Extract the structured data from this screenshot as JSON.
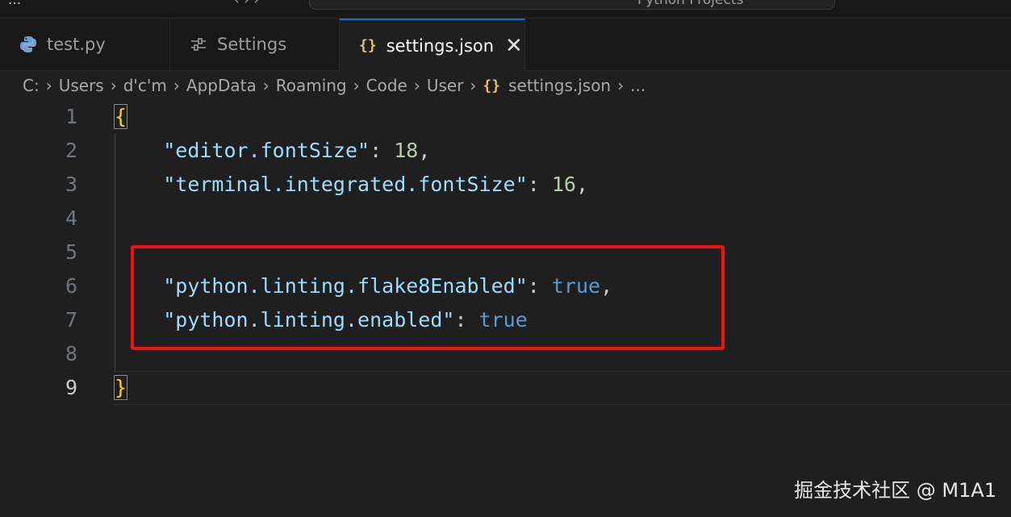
{
  "titlebar": {
    "left_text": "...",
    "nav_text": "‹ › ›",
    "command_center_text": "Python Projects"
  },
  "tabs": [
    {
      "label": "test.py",
      "icon": "python-icon",
      "active": false
    },
    {
      "label": "Settings",
      "icon": "settings-sliders-icon",
      "active": false
    },
    {
      "label": "settings.json",
      "icon": "json-braces-icon",
      "active": true,
      "close": "✕"
    }
  ],
  "breadcrumb": {
    "items": [
      "C:",
      "Users",
      "d'c'm",
      "AppData",
      "Roaming",
      "Code",
      "User",
      "settings.json",
      "..."
    ]
  },
  "editor": {
    "lines": [
      {
        "n": "1",
        "parts": [
          {
            "t": "{",
            "c": "brace"
          }
        ]
      },
      {
        "n": "2",
        "parts": [
          {
            "t": "    ",
            "c": "punc"
          },
          {
            "t": "\"editor.fontSize\"",
            "c": "key"
          },
          {
            "t": ": ",
            "c": "punc"
          },
          {
            "t": "18",
            "c": "num"
          },
          {
            "t": ",",
            "c": "punc"
          }
        ]
      },
      {
        "n": "3",
        "parts": [
          {
            "t": "    ",
            "c": "punc"
          },
          {
            "t": "\"terminal.integrated.fontSize\"",
            "c": "key"
          },
          {
            "t": ": ",
            "c": "punc"
          },
          {
            "t": "16",
            "c": "num"
          },
          {
            "t": ",",
            "c": "punc"
          }
        ]
      },
      {
        "n": "4",
        "parts": []
      },
      {
        "n": "5",
        "parts": []
      },
      {
        "n": "6",
        "parts": [
          {
            "t": "    ",
            "c": "punc"
          },
          {
            "t": "\"python.linting.flake8Enabled\"",
            "c": "key"
          },
          {
            "t": ": ",
            "c": "punc"
          },
          {
            "t": "true",
            "c": "bool"
          },
          {
            "t": ",",
            "c": "punc"
          }
        ]
      },
      {
        "n": "7",
        "parts": [
          {
            "t": "    ",
            "c": "punc"
          },
          {
            "t": "\"python.linting.enabled\"",
            "c": "key"
          },
          {
            "t": ": ",
            "c": "punc"
          },
          {
            "t": "true",
            "c": "bool"
          }
        ]
      },
      {
        "n": "8",
        "parts": []
      },
      {
        "n": "9",
        "parts": [
          {
            "t": "}",
            "c": "brace"
          }
        ],
        "current": true
      }
    ]
  },
  "watermark": "掘金技术社区 @ M1A1",
  "colors": {
    "highlight_box": "#f01010",
    "active_tab_accent": "#0078d4",
    "json_icon": "#e8c15c"
  }
}
